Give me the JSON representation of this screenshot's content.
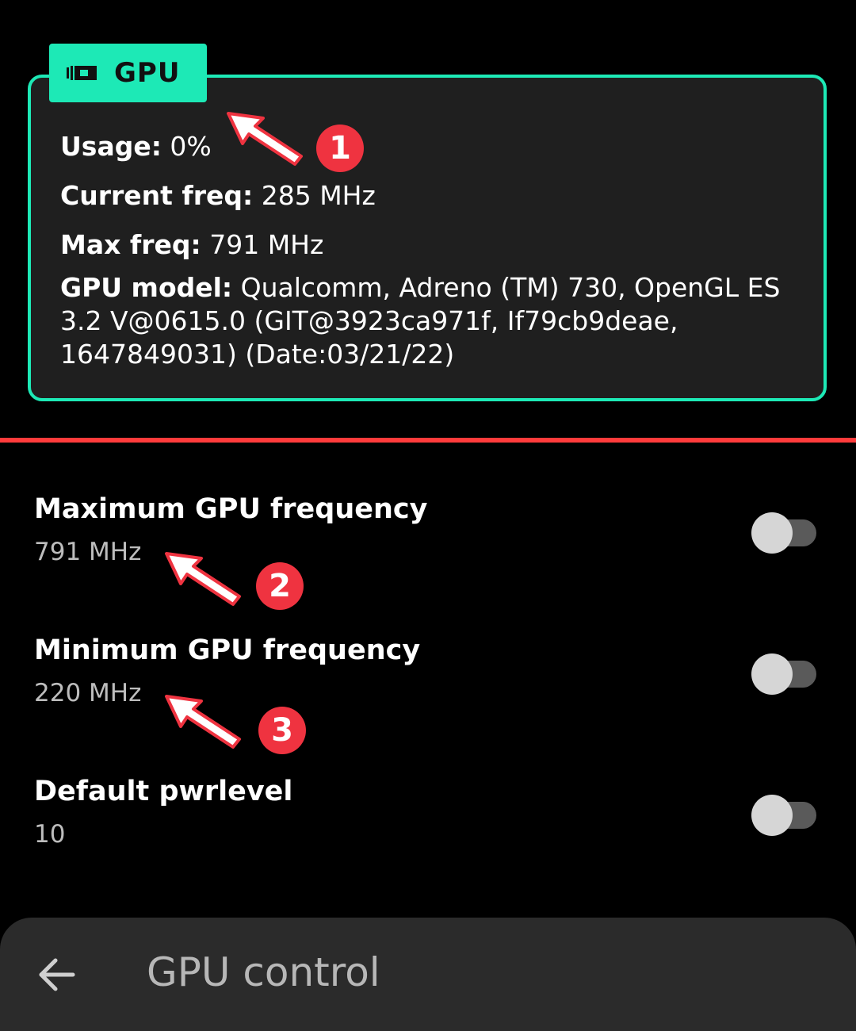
{
  "gpu_card": {
    "tag_label": "GPU",
    "tag_icon": "gpu-chip-icon",
    "accent_color": "#1de9b6",
    "usage": {
      "label": "Usage:",
      "value": "0%"
    },
    "current_freq": {
      "label": "Current freq:",
      "value": "285 MHz"
    },
    "max_freq": {
      "label": "Max freq:",
      "value": "791 MHz"
    },
    "gpu_model": {
      "label": "GPU model:",
      "value": "Qualcomm, Adreno (TM) 730, OpenGL ES 3.2 V@0615.0 (GIT@3923ca971f, If79cb9deae, 1647849031) (Date:03/21/22)"
    }
  },
  "divider_color": "#ff3b3b",
  "settings": [
    {
      "title": "Maximum GPU frequency",
      "value": "791 MHz",
      "enabled": false
    },
    {
      "title": "Minimum GPU frequency",
      "value": "220 MHz",
      "enabled": false
    },
    {
      "title": "Default pwrlevel",
      "value": "10",
      "enabled": false
    }
  ],
  "annotations": [
    {
      "number": "1",
      "color": "#ef3340"
    },
    {
      "number": "2",
      "color": "#ef3340"
    },
    {
      "number": "3",
      "color": "#ef3340"
    }
  ],
  "bottom_bar": {
    "back_icon": "back-arrow-icon",
    "title": "GPU control"
  }
}
